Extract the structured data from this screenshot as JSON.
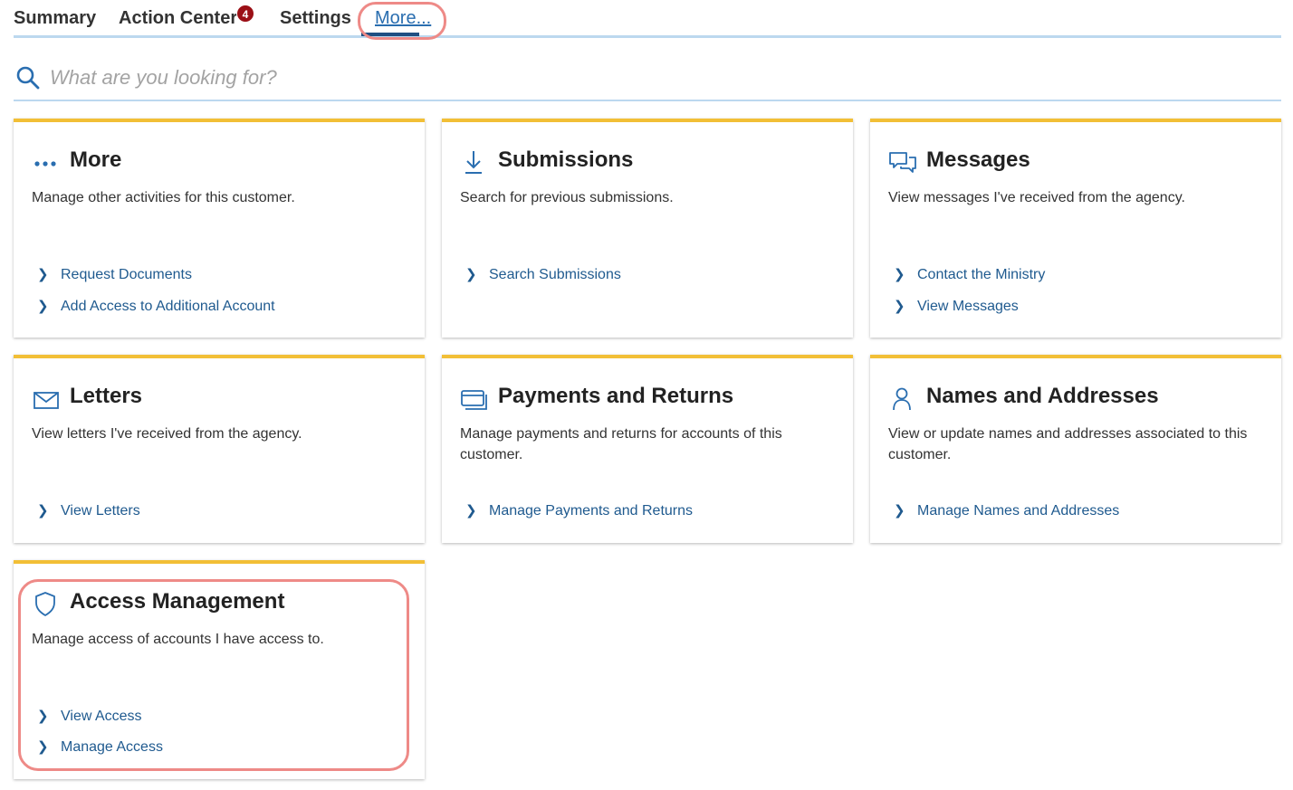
{
  "tabs": {
    "summary": "Summary",
    "action_center": "Action Center",
    "action_center_badge": "4",
    "settings": "Settings",
    "more": "More..."
  },
  "search": {
    "placeholder": "What are you looking for?"
  },
  "colors": {
    "accent": "#f2bf36",
    "link": "#1f5a8f",
    "badge": "#9b0f16",
    "highlight": "#ee8a87"
  },
  "cards": {
    "more": {
      "icon": "ellipsis-icon",
      "title": "More",
      "description": "Manage other activities for this customer.",
      "links": [
        "Request Documents",
        "Add Access to Additional Account"
      ]
    },
    "submissions": {
      "icon": "download-icon",
      "title": "Submissions",
      "description": "Search for previous submissions.",
      "links": [
        "Search Submissions"
      ]
    },
    "messages": {
      "icon": "chat-icon",
      "title": "Messages",
      "description": "View messages I've received from the agency.",
      "links": [
        "Contact the Ministry",
        "View Messages"
      ]
    },
    "letters": {
      "icon": "envelope-icon",
      "title": "Letters",
      "description": "View letters I've received from the agency.",
      "links": [
        "View Letters"
      ]
    },
    "payments": {
      "icon": "payment-card-icon",
      "title": "Payments and Returns",
      "description": "Manage payments and returns for accounts of this customer.",
      "links": [
        "Manage Payments and Returns"
      ]
    },
    "names": {
      "icon": "person-icon",
      "title": "Names and Addresses",
      "description": "View or update names and addresses associated to this customer.",
      "links": [
        "Manage Names and Addresses"
      ]
    },
    "access": {
      "icon": "shield-icon",
      "title": "Access Management",
      "description": "Manage access of accounts I have access to.",
      "links": [
        "View Access",
        "Manage Access"
      ]
    }
  }
}
